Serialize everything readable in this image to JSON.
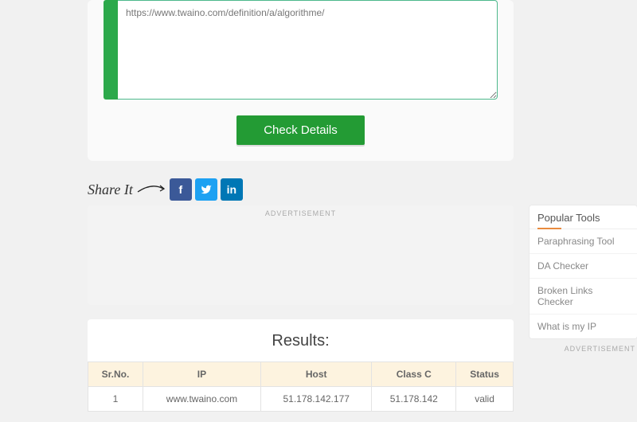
{
  "input": {
    "value": "https://www.twaino.com/definition/a/algorithme/"
  },
  "buttons": {
    "check": "Check Details"
  },
  "share": {
    "label": "Share It"
  },
  "ad": {
    "label": "ADVERTISEMENT"
  },
  "results": {
    "title": "Results:",
    "headers": {
      "sr": "Sr.No.",
      "ip": "IP",
      "host": "Host",
      "classc": "Class C",
      "status": "Status"
    },
    "rows": [
      {
        "sr": "1",
        "ip": "www.twaino.com",
        "host": "51.178.142.177",
        "classc": "51.178.142",
        "status": "valid"
      }
    ]
  },
  "sidebar": {
    "title": "Popular Tools",
    "items": [
      "Paraphrasing Tool",
      "DA Checker",
      "Broken Links Checker",
      "What is my IP"
    ],
    "ad_label": "ADVERTISEMENT"
  }
}
